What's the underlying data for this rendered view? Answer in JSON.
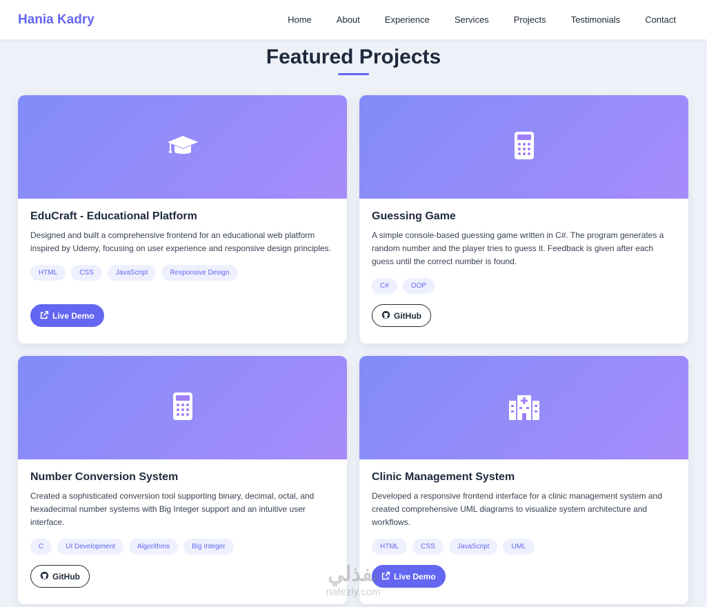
{
  "nav": {
    "brand": "Hania Kadry",
    "links": [
      "Home",
      "About",
      "Experience",
      "Services",
      "Projects",
      "Testimonials",
      "Contact"
    ]
  },
  "section": {
    "title": "Featured Projects"
  },
  "colors": {
    "accent": "#6366f1",
    "banner_start": "#818cf8",
    "banner_end": "#a78bfa",
    "background": "#eef1f8"
  },
  "projects": [
    {
      "icon": "graduation-cap-icon",
      "title": "EduCraft - Educational Platform",
      "description": "Designed and built a comprehensive frontend for an educational web platform inspired by Udemy, focusing on user experience and responsive design principles.",
      "tags": [
        "HTML",
        "CSS",
        "JavaScript",
        "Responsive Design"
      ],
      "button": {
        "type": "demo",
        "label": "Live Demo",
        "icon": "external-link-icon"
      }
    },
    {
      "icon": "calculator-icon",
      "title": "Guessing Game",
      "description": "A simple console-based guessing game written in C#. The program generates a random number and the player tries to guess it. Feedback is given after each guess until the correct number is found.",
      "tags": [
        "C#",
        "OOP"
      ],
      "button": {
        "type": "github",
        "label": "GitHub",
        "icon": "github-icon"
      }
    },
    {
      "icon": "calculator-icon",
      "title": "Number Conversion System",
      "description": "Created a sophisticated conversion tool supporting binary, decimal, octal, and hexadecimal number systems with Big Integer support and an intuitive user interface.",
      "tags": [
        "C",
        "UI Development",
        "Algorithms",
        "Big Integer"
      ],
      "button": {
        "type": "github",
        "label": "GitHub",
        "icon": "github-icon"
      }
    },
    {
      "icon": "hospital-icon",
      "title": "Clinic Management System",
      "description": "Developed a responsive frontend interface for a clinic management system and created comprehensive UML diagrams to visualize system architecture and workflows.",
      "tags": [
        "HTML",
        "CSS",
        "JavaScript",
        "UML"
      ],
      "button": {
        "type": "demo",
        "label": "Live Demo",
        "icon": "external-link-icon"
      }
    }
  ],
  "watermark": {
    "logo": "نفذلي",
    "text": "nafezly.com"
  }
}
